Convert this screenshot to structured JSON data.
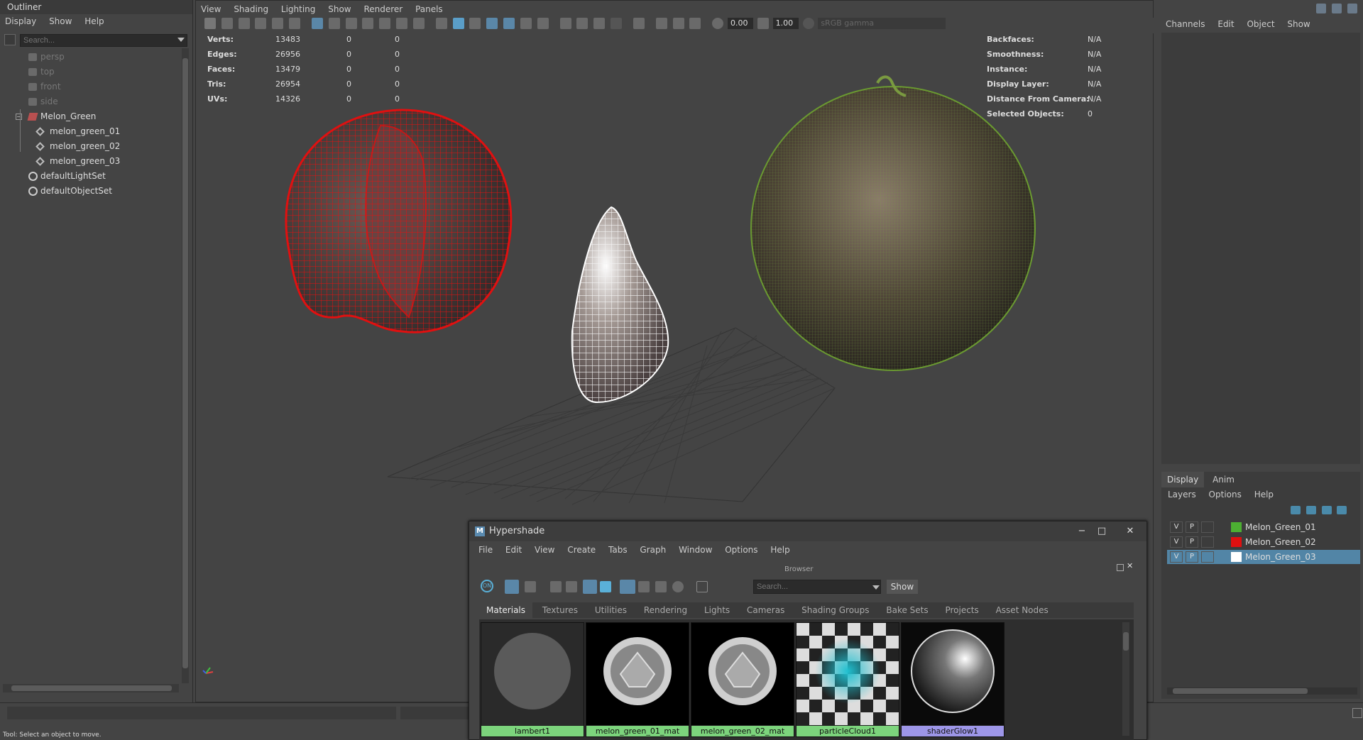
{
  "outliner": {
    "title": "Outliner",
    "menu": [
      "Display",
      "Show",
      "Help"
    ],
    "search_placeholder": "Search...",
    "items": [
      {
        "label": "persp",
        "dim": true
      },
      {
        "label": "top",
        "dim": true
      },
      {
        "label": "front",
        "dim": true
      },
      {
        "label": "side",
        "dim": true
      },
      {
        "label": "Melon_Green",
        "dim": false
      },
      {
        "label": "melon_green_01",
        "dim": false
      },
      {
        "label": "melon_green_02",
        "dim": false
      },
      {
        "label": "melon_green_03",
        "dim": false
      },
      {
        "label": "defaultLightSet",
        "dim": false
      },
      {
        "label": "defaultObjectSet",
        "dim": false
      }
    ]
  },
  "viewport": {
    "menu": [
      "View",
      "Shading",
      "Lighting",
      "Show",
      "Renderer",
      "Panels"
    ],
    "toolbar": {
      "exposure": "0.00",
      "gamma": "1.00",
      "color_space": "sRGB gamma"
    },
    "hud_left": [
      {
        "label": "Verts:",
        "v1": "13483",
        "v2": "0",
        "v3": "0"
      },
      {
        "label": "Edges:",
        "v1": "26956",
        "v2": "0",
        "v3": "0"
      },
      {
        "label": "Faces:",
        "v1": "13479",
        "v2": "0",
        "v3": "0"
      },
      {
        "label": "Tris:",
        "v1": "26954",
        "v2": "0",
        "v3": "0"
      },
      {
        "label": "UVs:",
        "v1": "14326",
        "v2": "0",
        "v3": "0"
      }
    ],
    "hud_right": [
      {
        "label": "Backfaces:",
        "value": "N/A"
      },
      {
        "label": "Smoothness:",
        "value": "N/A"
      },
      {
        "label": "Instance:",
        "value": "N/A"
      },
      {
        "label": "Display Layer:",
        "value": "N/A"
      },
      {
        "label": "Distance From Camera:",
        "value": "N/A"
      },
      {
        "label": "Selected Objects:",
        "value": "0"
      }
    ]
  },
  "channel_box": {
    "menu": [
      "Channels",
      "Edit",
      "Object",
      "Show"
    ],
    "layer_tabs": [
      "Display",
      "Anim"
    ],
    "layer_menu": [
      "Layers",
      "Options",
      "Help"
    ],
    "layers": [
      {
        "v": "V",
        "p": "P",
        "name": "Melon_Green_01",
        "color": "#4caf32",
        "selected": false
      },
      {
        "v": "V",
        "p": "P",
        "name": "Melon_Green_02",
        "color": "#e01010",
        "selected": false
      },
      {
        "v": "V",
        "p": "P",
        "name": "Melon_Green_03",
        "color": "#ffffff",
        "selected": true
      }
    ]
  },
  "hypershade": {
    "title": "Hypershade",
    "menu": [
      "File",
      "Edit",
      "View",
      "Create",
      "Tabs",
      "Graph",
      "Window",
      "Options",
      "Help"
    ],
    "browser_label": "Browser",
    "on_label": "ON",
    "search_placeholder": "Search...",
    "show_label": "Show",
    "tabs": [
      "Materials",
      "Textures",
      "Utilities",
      "Rendering",
      "Lights",
      "Cameras",
      "Shading Groups",
      "Bake Sets",
      "Projects",
      "Asset Nodes"
    ],
    "materials": [
      "lambert1",
      "melon_green_01_mat",
      "melon_green_02_mat",
      "particleCloud1",
      "shaderGlow1"
    ]
  },
  "help_line": "Tool: Select an object to move."
}
